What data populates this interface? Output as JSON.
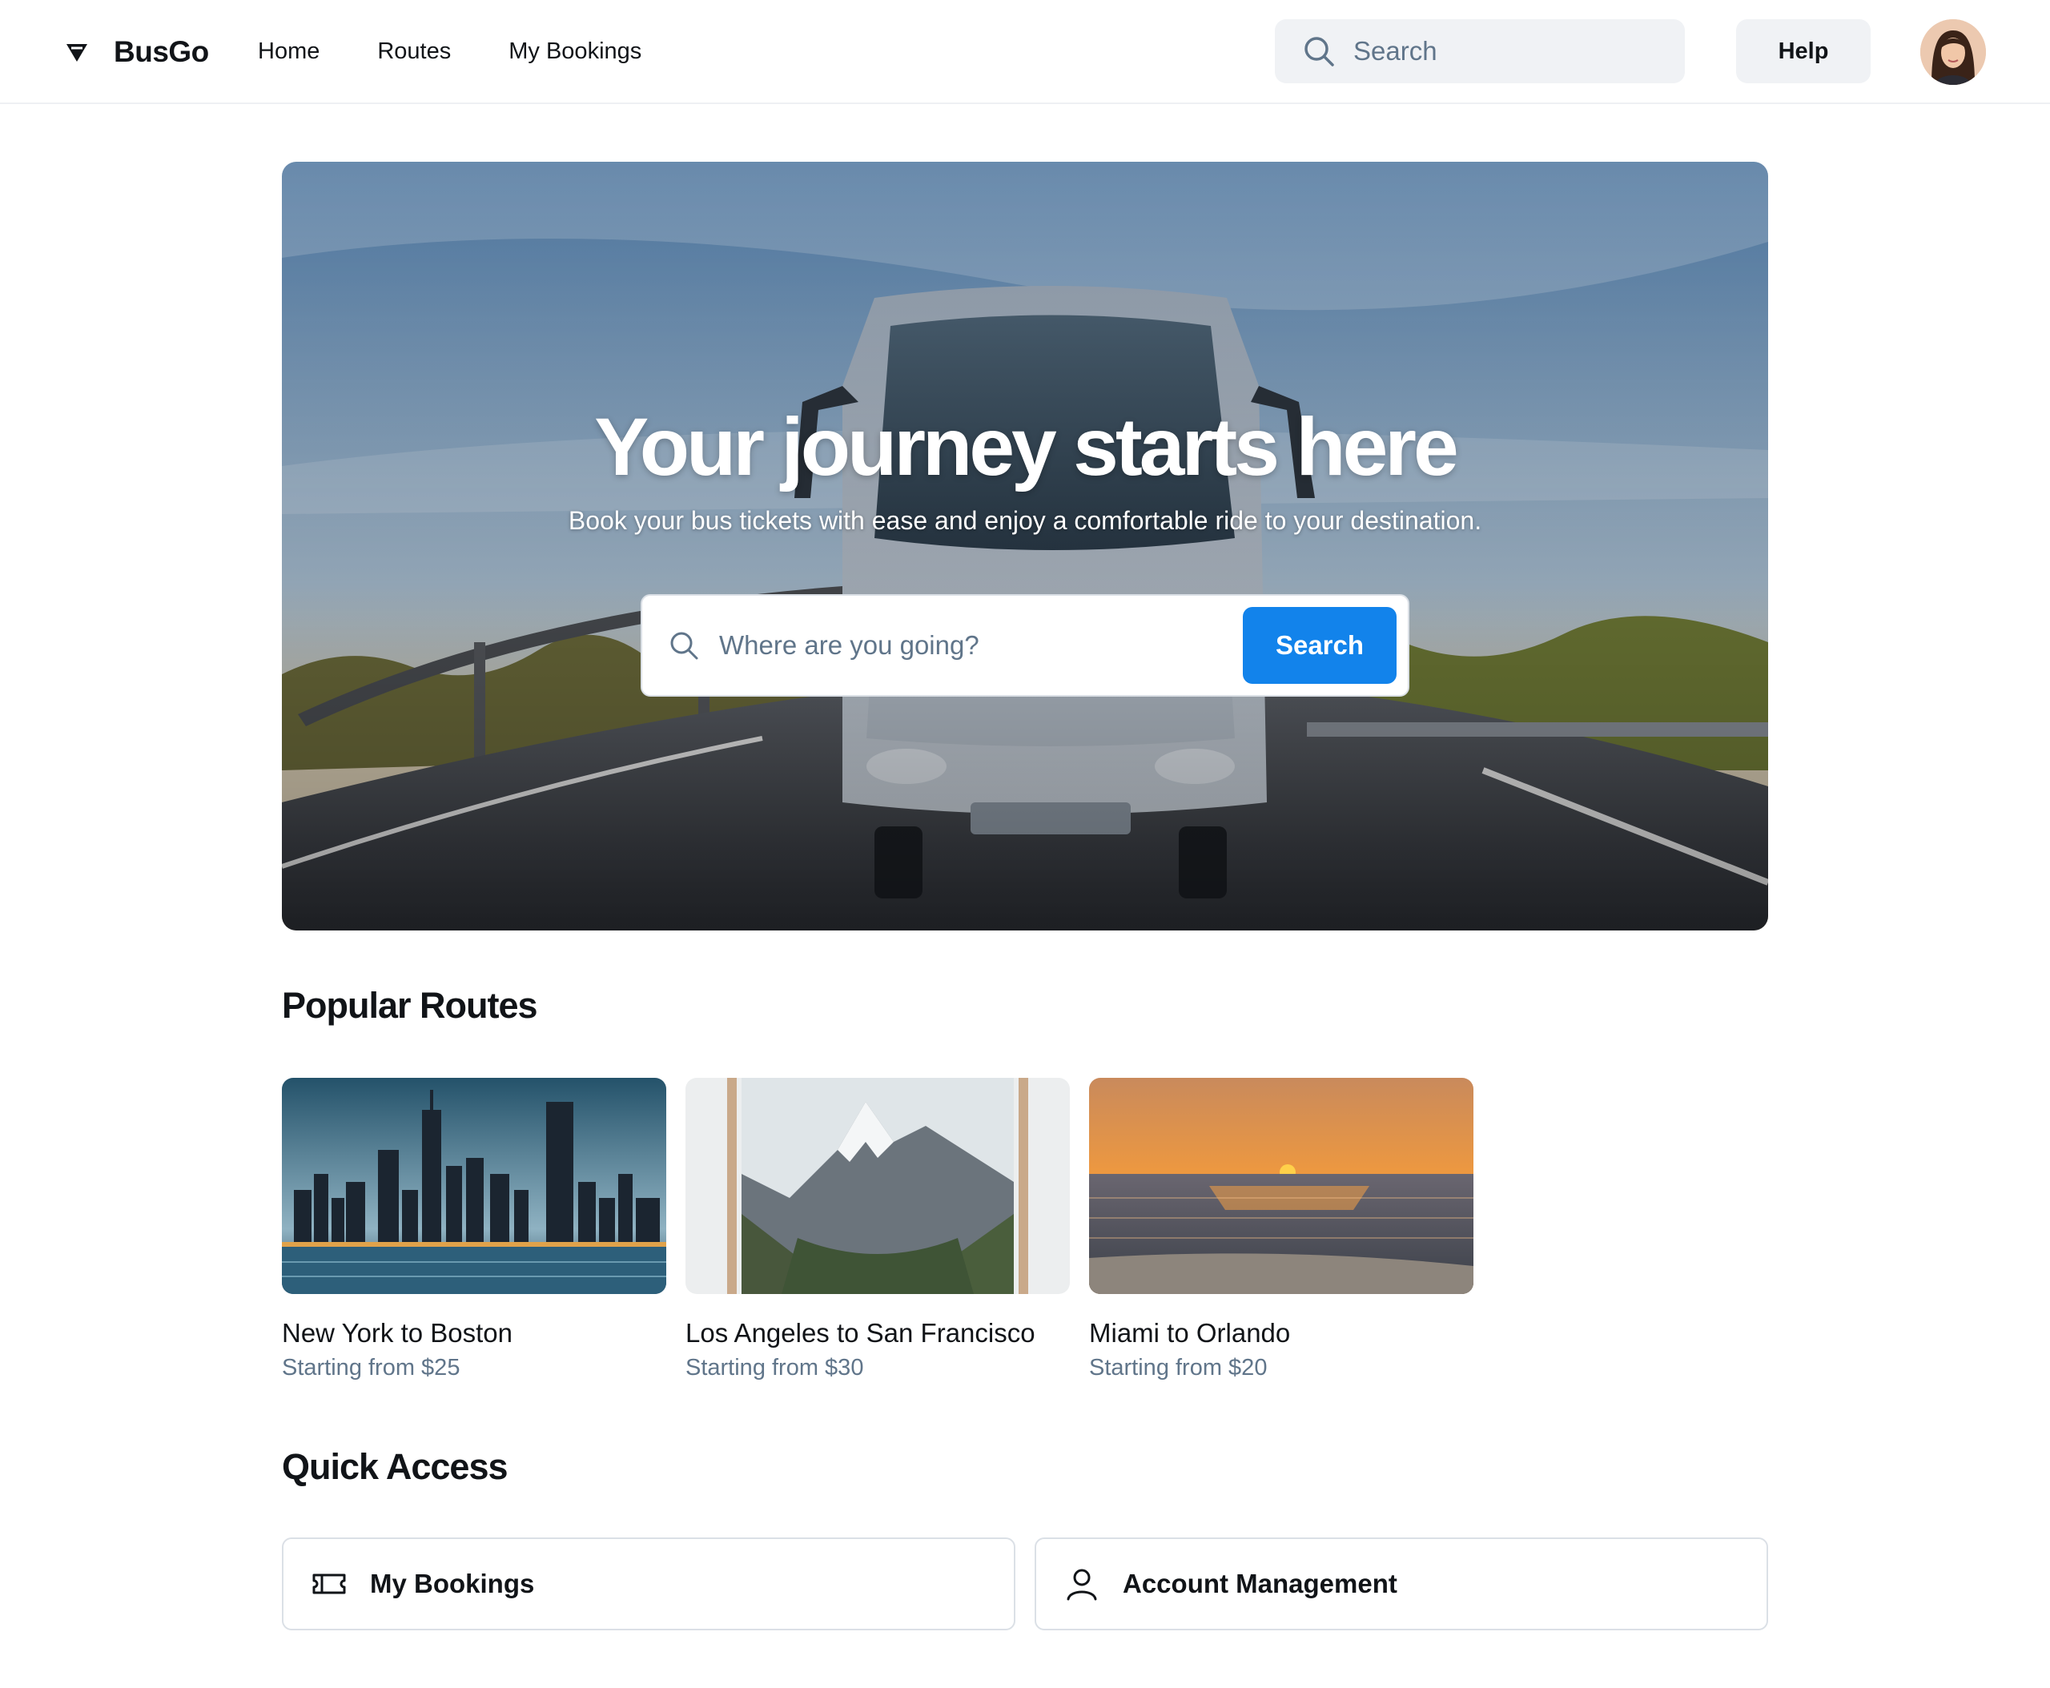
{
  "header": {
    "brand": "BusGo",
    "nav": [
      "Home",
      "Routes",
      "My Bookings"
    ],
    "search_placeholder": "Search",
    "help_label": "Help"
  },
  "hero": {
    "title": "Your journey starts here",
    "subtitle": "Book your bus tickets with ease and enjoy a comfortable ride to your destination.",
    "search_placeholder": "Where are you going?",
    "search_button": "Search"
  },
  "popular": {
    "title": "Popular Routes",
    "routes": [
      {
        "name": "New York to Boston",
        "price": "Starting from $25",
        "image": "city-skyline"
      },
      {
        "name": "Los Angeles to San Francisco",
        "price": "Starting from $30",
        "image": "mountain"
      },
      {
        "name": "Miami to Orlando",
        "price": "Starting from $20",
        "image": "sunset-beach"
      }
    ]
  },
  "quick_access": {
    "title": "Quick Access",
    "items": [
      {
        "label": "My Bookings",
        "icon": "ticket-icon"
      },
      {
        "label": "Account Management",
        "icon": "user-icon"
      }
    ]
  },
  "colors": {
    "accent": "#1283eb",
    "muted_text": "#60758a",
    "surface": "#f0f2f5",
    "border": "#dbe0e6"
  }
}
